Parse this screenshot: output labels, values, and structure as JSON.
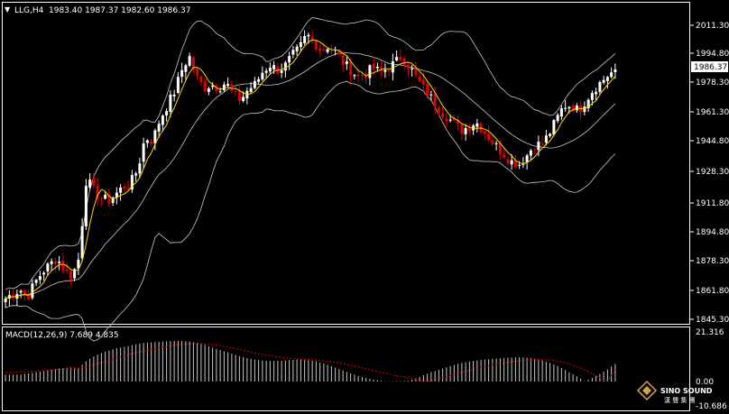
{
  "header": {
    "menu_glyph": "▼",
    "symbol": "LLG,H4",
    "ohlc": "1983.40 1987.37 1982.60 1986.37"
  },
  "price_axis": {
    "labels": [
      "2011.30",
      "1994.80",
      "1978.30",
      "1961.30",
      "1944.80",
      "1928.30",
      "1911.80",
      "1894.80",
      "1878.30",
      "1861.80",
      "1845.30"
    ],
    "current_price_label": "1986.37"
  },
  "macd": {
    "label": "MACD(12,26,9) 7.689 4.835",
    "axis_labels": [
      "21.316",
      "0.00",
      "-10.686"
    ]
  },
  "watermark": {
    "brand": "SINO SOUND",
    "subtitle": "漢 聲 集 團"
  },
  "colors": {
    "background": "#000000",
    "bull_candle": "#ffffff",
    "bear_candle": "#e00000",
    "ma_line": "#ffd700",
    "band_line": "#c8c8c8",
    "signal_line": "#e00000",
    "histogram": "#c8c8c8"
  },
  "chart_data": {
    "type": "candlestick",
    "symbol": "LLG",
    "timeframe": "H4",
    "ylim": [
      1845.3,
      2011.3
    ],
    "close_path": [
      1857,
      1860,
      1862,
      1858,
      1866,
      1872,
      1876,
      1880,
      1873,
      1869,
      1880,
      1925,
      1918,
      1914,
      1912,
      1916,
      1920,
      1922,
      1930,
      1948,
      1946,
      1958,
      1966,
      1974,
      1986,
      1994,
      1982,
      1976,
      1978,
      1976,
      1979,
      1972,
      1969,
      1975,
      1978,
      1985,
      1989,
      1986,
      1988,
      1994,
      1998,
      2006,
      2002,
      1997,
      2000,
      1996,
      1990,
      1986,
      1982,
      1984,
      1987,
      1985,
      1987,
      1990,
      1994,
      1988,
      1981,
      1975,
      1970,
      1964,
      1960,
      1956,
      1952,
      1954,
      1957,
      1952,
      1947,
      1942,
      1938,
      1934,
      1933,
      1938,
      1944,
      1944,
      1950,
      1958,
      1966,
      1966,
      1963,
      1969,
      1975,
      1979,
      1983,
      1986
    ],
    "macd_hist_path": [
      3.0,
      3.0,
      3.0,
      3.5,
      4.0,
      4.5,
      5.0,
      5.5,
      6.0,
      6.2,
      6.0,
      9.0,
      11.0,
      12.5,
      13.5,
      14.5,
      15.0,
      15.8,
      16.5,
      17.0,
      17.2,
      17.4,
      17.6,
      17.8,
      17.8,
      17.6,
      17.0,
      16.2,
      15.0,
      14.0,
      13.0,
      12.0,
      11.0,
      10.2,
      9.6,
      9.2,
      9.0,
      9.0,
      9.2,
      9.5,
      9.6,
      9.4,
      9.0,
      8.2,
      7.2,
      6.0,
      4.8,
      3.6,
      2.5,
      1.6,
      0.9,
      0.4,
      0.0,
      -0.2,
      -0.2,
      -0.4,
      -1.5,
      -2.8,
      -4.0,
      -5.0,
      -6.0,
      -7.0,
      -7.8,
      -8.4,
      -8.9,
      -9.2,
      -9.5,
      -9.8,
      -10.0,
      -10.2,
      -10.3,
      -10.1,
      -9.7,
      -9.0,
      -8.0,
      -6.8,
      -5.2,
      -3.5,
      -1.8,
      0.2,
      1.8,
      3.5,
      5.5,
      7.7
    ],
    "macd_signal_path": [
      4.0,
      4.0,
      4.2,
      4.4,
      4.6,
      4.8,
      5.0,
      5.2,
      5.4,
      5.6,
      5.8,
      6.4,
      7.2,
      8.2,
      9.2,
      10.2,
      11.1,
      12.0,
      12.8,
      13.6,
      14.3,
      14.9,
      15.4,
      15.9,
      16.3,
      16.5,
      16.6,
      16.5,
      16.2,
      15.8,
      15.2,
      14.6,
      13.9,
      13.2,
      12.5,
      11.9,
      11.3,
      10.8,
      10.4,
      10.1,
      9.9,
      9.7,
      9.5,
      9.2,
      8.9,
      8.4,
      7.8,
      7.1,
      6.4,
      5.6,
      4.9,
      4.1,
      3.4,
      2.7,
      2.1,
      1.5,
      0.9,
      0.3,
      -0.4,
      -1.2,
      -2.0,
      -2.9,
      -3.8,
      -4.6,
      -5.4,
      -6.1,
      -6.8,
      -7.4,
      -7.9,
      -8.4,
      -8.8,
      -9.1,
      -9.3,
      -9.3,
      -9.2,
      -8.8,
      -8.1,
      -7.2,
      -6.1,
      -4.8,
      -3.2,
      -1.5,
      0.6,
      4.8
    ]
  }
}
